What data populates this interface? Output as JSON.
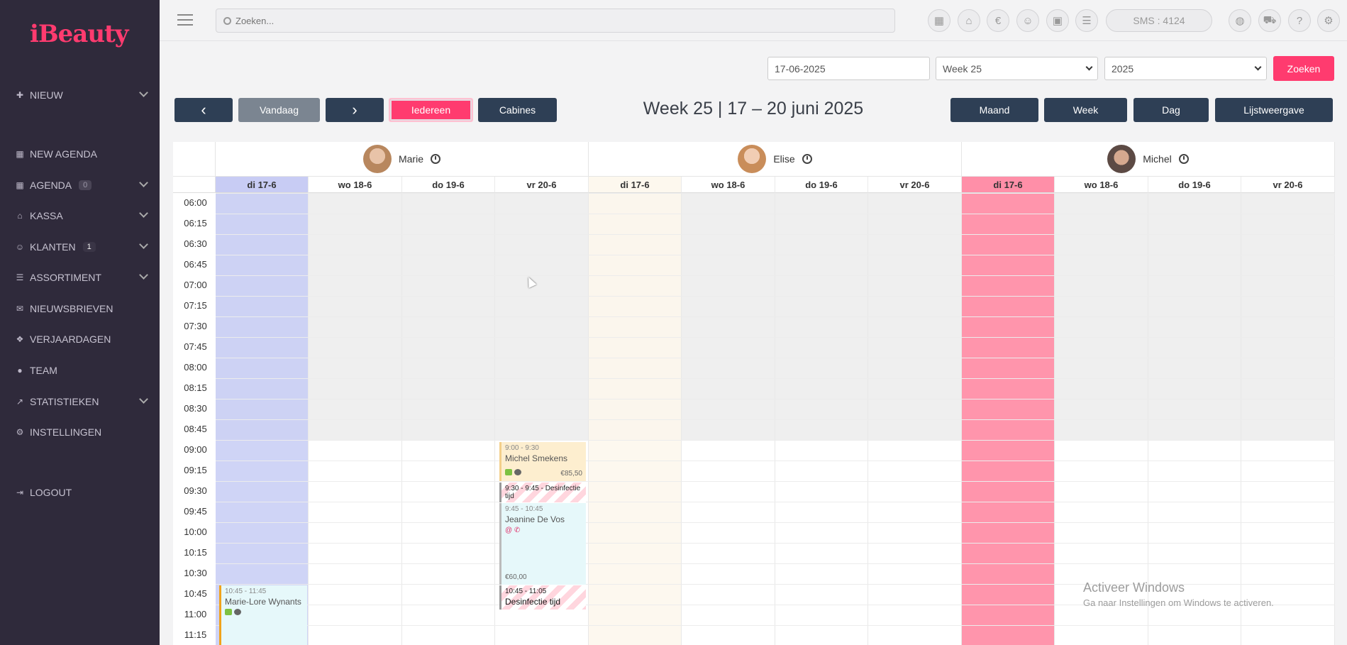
{
  "sidebar": {
    "logo": "iBeauty",
    "items": [
      {
        "label": "NIEUW",
        "icon": "plus-icon"
      },
      {
        "label": "NEW AGENDA",
        "icon": "calendar-icon"
      },
      {
        "label": "AGENDA",
        "icon": "calendar-icon",
        "badge": "0"
      },
      {
        "label": "KASSA",
        "icon": "basket-icon"
      },
      {
        "label": "KLANTEN",
        "icon": "users-icon",
        "badge": "1"
      },
      {
        "label": "ASSORTIMENT",
        "icon": "list-icon"
      },
      {
        "label": "NIEUWSBRIEVEN",
        "icon": "envelope-icon"
      },
      {
        "label": "VERJAARDAGEN",
        "icon": "gift-icon"
      },
      {
        "label": "TEAM",
        "icon": "user-icon"
      },
      {
        "label": "STATISTIEKEN",
        "icon": "chart-icon"
      },
      {
        "label": "INSTELLINGEN",
        "icon": "cogs-icon"
      },
      {
        "label": "LOGOUT",
        "icon": "sign-out-icon"
      }
    ]
  },
  "topbar": {
    "search_placeholder": "Zoeken...",
    "sms": "SMS : 4124",
    "icons": {
      "calendar": "▦",
      "basket": "⌂",
      "euro": "€",
      "users": "☺",
      "briefcase": "▣",
      "list": "☰",
      "globe": "◍",
      "cart": "⛟",
      "help": "?",
      "settings": "⚙"
    }
  },
  "filters": {
    "date": "17-06-2025",
    "week": "Week 25",
    "year": "2025",
    "search_button": "Zoeken"
  },
  "toolbar": {
    "prev": "‹",
    "today": "Vandaag",
    "next": "›",
    "everyone": "Iedereen",
    "cabins": "Cabines",
    "title": "Week 25 | 17 – 20 juni 2025",
    "month": "Maand",
    "week": "Week",
    "day": "Dag",
    "list": "Lijstweergave"
  },
  "calendar": {
    "staff": [
      "Marie",
      "Elise",
      "Michel"
    ],
    "days": [
      "di 17-6",
      "wo 18-6",
      "do 19-6",
      "vr 20-6"
    ],
    "times": [
      "06:00",
      "06:15",
      "06:30",
      "06:45",
      "07:00",
      "07:15",
      "07:30",
      "07:45",
      "08:00",
      "08:15",
      "08:30",
      "08:45",
      "09:00",
      "09:15",
      "09:30",
      "09:45",
      "10:00",
      "10:15",
      "10:30",
      "10:45",
      "11:00",
      "11:15"
    ],
    "events": [
      {
        "time": "9:00 - 9:30",
        "name": "Michel Smekens",
        "price": "€85,50"
      },
      {
        "time": "9:30 - 9:45 - Desinfectie tijd"
      },
      {
        "time": "9:45 - 10:45",
        "name": "Jeanine De Vos",
        "price": "€60,00"
      },
      {
        "time": "10:45 - 11:05",
        "name": "Desinfectie tijd"
      },
      {
        "time": "10:45 - 11:45",
        "name": "Marie-Lore Wynants"
      }
    ]
  },
  "watermark": {
    "title": "Activeer Windows",
    "subtitle": "Ga naar Instellingen om Windows te activeren."
  }
}
